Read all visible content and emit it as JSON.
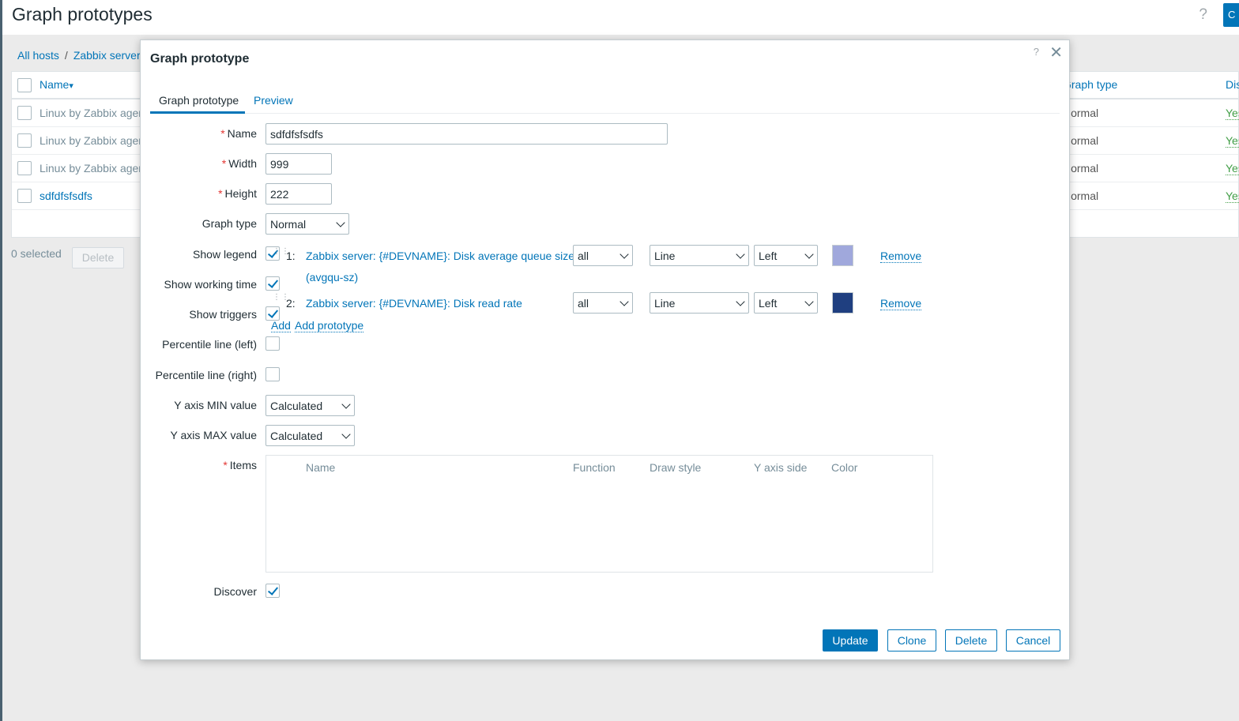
{
  "page": {
    "title": "Graph prototypes",
    "help": "?",
    "create_initial": "C"
  },
  "breadcrumbs": [
    "All hosts",
    "/",
    "Zabbix server"
  ],
  "bg_table": {
    "columns": {
      "name": "Name",
      "sort_indicator": "▾",
      "graph_type": "Graph type",
      "discover": "Dis"
    },
    "rows": [
      {
        "name": "Linux by Zabbix agent",
        "type": "Normal",
        "discover": "Yes"
      },
      {
        "name": "Linux by Zabbix agent",
        "type": "Normal",
        "discover": "Yes"
      },
      {
        "name": "Linux by Zabbix agent",
        "type": "Normal",
        "discover": "Yes"
      },
      {
        "name": "sdfdfsfsdfs",
        "type": "Normal",
        "discover": "Yes"
      }
    ],
    "selected_text": "0 selected",
    "delete_label": "Delete"
  },
  "dialog": {
    "title": "Graph prototype",
    "help": "?",
    "close": "✕",
    "tabs": [
      "Graph prototype",
      "Preview"
    ],
    "fields": {
      "name_label": "Name",
      "name_value": "sdfdfsfsdfs",
      "width_label": "Width",
      "width_value": "999",
      "height_label": "Height",
      "height_value": "222",
      "graph_type_label": "Graph type",
      "graph_type_value": "Normal",
      "show_legend_label": "Show legend",
      "show_working_time_label": "Show working time",
      "show_triggers_label": "Show triggers",
      "percentile_left_label": "Percentile line (left)",
      "percentile_right_label": "Percentile line (right)",
      "ymin_label": "Y axis MIN value",
      "ymin_value": "Calculated",
      "ymax_label": "Y axis MAX value",
      "ymax_value": "Calculated",
      "items_label": "Items",
      "discover_label": "Discover",
      "required_mark": "*"
    },
    "graph_items": [
      {
        "index": "1:",
        "name_line1": "Zabbix server: {#DEVNAME}: Disk average queue size",
        "name_line2": "(avgqu-sz)",
        "function": "all",
        "draw_style": "Line",
        "y_axis_side": "Left",
        "color": "#A0A8DC",
        "remove": "Remove"
      },
      {
        "index": "2:",
        "name_line1": "Zabbix server: {#DEVNAME}: Disk read rate",
        "name_line2": "",
        "function": "all",
        "draw_style": "Line",
        "y_axis_side": "Left",
        "color": "#1F3F80",
        "remove": "Remove"
      }
    ],
    "add_links": {
      "add": "Add",
      "add_prototype": "Add prototype"
    },
    "items_table_headers": [
      "Name",
      "Function",
      "Draw style",
      "Y axis side",
      "Color"
    ],
    "buttons": {
      "update": "Update",
      "clone": "Clone",
      "delete": "Delete",
      "cancel": "Cancel"
    }
  },
  "colors": {
    "accent": "#0275B8",
    "required": "#E33734",
    "yes": "#429E47"
  }
}
